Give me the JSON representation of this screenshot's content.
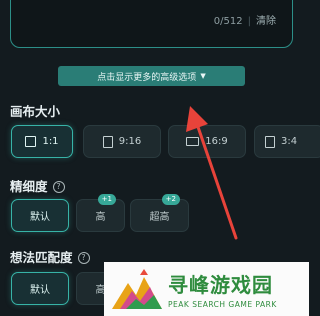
{
  "prompt_box": {
    "counter": "0/512",
    "separator": "|",
    "clear_label": "清除"
  },
  "advanced_button": {
    "label": "点击显示更多的高级选项",
    "icon": "caret-down-icon"
  },
  "canvas_size": {
    "title": "画布大小",
    "options": [
      {
        "label": "1:1",
        "selected": true
      },
      {
        "label": "9:16",
        "selected": false
      },
      {
        "label": "16:9",
        "selected": false
      },
      {
        "label": "3:4",
        "selected": false
      }
    ]
  },
  "refinement": {
    "title": "精细度",
    "help": "?",
    "options": [
      {
        "label": "默认",
        "selected": true,
        "badge": ""
      },
      {
        "label": "高",
        "selected": false,
        "badge": "+1"
      },
      {
        "label": "超高",
        "selected": false,
        "badge": "+2"
      }
    ]
  },
  "idea_match": {
    "title": "想法匹配度",
    "help": "?",
    "options": [
      {
        "label": "默认",
        "selected": true
      },
      {
        "label": "高",
        "selected": false
      }
    ]
  },
  "watermark": {
    "title": "寻峰游戏园",
    "subtitle": "PEAK SEARCH GAME PARK"
  },
  "colors": {
    "accent": "#37b3a7",
    "button": "#2a7d76",
    "background": "#131b1f",
    "arrow": "#e8433a"
  }
}
